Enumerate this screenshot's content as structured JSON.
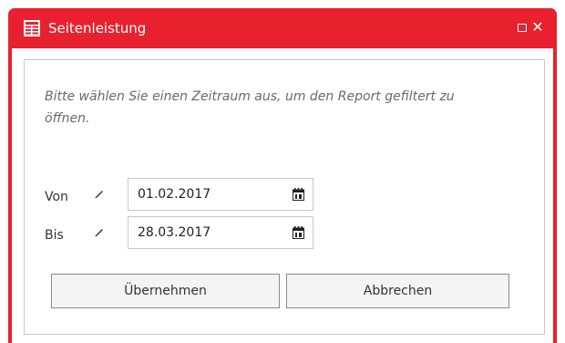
{
  "window": {
    "title": "Seitenleistung",
    "icon": "table-report-icon",
    "accent_color": "#e8212f",
    "maximize_icon": "maximize-icon",
    "close_label": "✕"
  },
  "form": {
    "instruction": "Bitte wählen Sie einen Zeitraum aus, um den Report gefiltert zu öffnen.",
    "from": {
      "label": "Von",
      "value": "01.02.2017"
    },
    "to": {
      "label": "Bis",
      "value": "28.03.2017"
    }
  },
  "buttons": {
    "apply_label": "Übernehmen",
    "cancel_label": "Abbrechen"
  }
}
